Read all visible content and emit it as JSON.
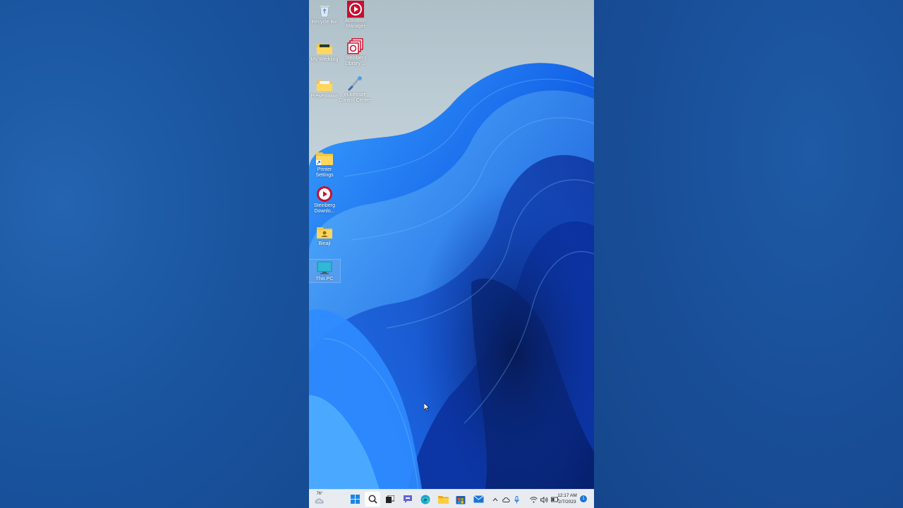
{
  "desktop": {
    "icons": [
      {
        "label": "Recycle Bin",
        "icon": "recycle-bin-icon"
      },
      {
        "label": "Activation Manager",
        "icon": "activation-manager-icon"
      },
      {
        "label": "My Wedding",
        "icon": "folder-icon"
      },
      {
        "label": "Steinberg Library ...",
        "icon": "steinberg-library-icon"
      },
      {
        "label": "Presentation",
        "icon": "folder-icon"
      },
      {
        "label": "eLicenser Control Center",
        "icon": "elicenser-icon"
      },
      {
        "label": "Printer Settings",
        "icon": "folder-shortcut-icon"
      },
      {
        "label": "Steinberg Downlo...",
        "icon": "steinberg-download-icon"
      },
      {
        "label": "Binaji",
        "icon": "user-folder-icon"
      },
      {
        "label": "This PC",
        "icon": "monitor-icon"
      }
    ]
  },
  "taskbar": {
    "weather_temp": "76°",
    "clock_time": "12:17 AM",
    "clock_date": "2/7/2023",
    "notification_count": "1",
    "apps": [
      "start",
      "search",
      "task-view",
      "teams-chat",
      "edge",
      "file-explorer",
      "microsoft-store",
      "mail"
    ]
  },
  "colors": {
    "accent": "#1a73d9",
    "taskbar_bg": "#e8ecf1",
    "background_blue": "#174f99"
  }
}
